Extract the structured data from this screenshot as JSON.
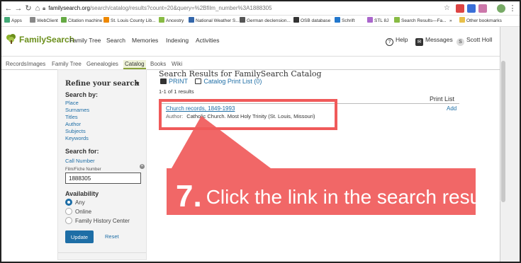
{
  "browser": {
    "url_host": "familysearch.org",
    "url_path": "/search/catalog/results?count=20&query=%2Bfilm_number%3A1888305",
    "bookmarks": [
      "Apps",
      "WebClient",
      "Citation machine",
      "St. Louis County Lib...",
      "Ancestry",
      "National Weather S...",
      "German declension...",
      "OSB database",
      "Schrift",
      "STL 8J",
      "Search Results—Fa...",
      "»",
      "Other bookmarks"
    ]
  },
  "site": {
    "logo": "FamilySearch",
    "nav": [
      "Family Tree",
      "Search",
      "Memories",
      "Indexing",
      "Activities"
    ],
    "help": "Help",
    "messages": "Messages",
    "user_initial": "S",
    "user_name": "Scott Holl",
    "subnav": [
      "Records",
      "Images",
      "Family Tree",
      "Genealogies",
      "Catalog",
      "Books",
      "Wiki"
    ]
  },
  "sidebar": {
    "title": "Refine your search",
    "search_by": "Search by:",
    "search_by_links": [
      "Place",
      "Surnames",
      "Titles",
      "Author",
      "Subjects",
      "Keywords"
    ],
    "search_for": "Search for:",
    "call_number": "Call Number",
    "film_label": "Film/Fiche Number",
    "film_value": "1888305",
    "availability": "Availability",
    "availability_options": [
      "Any",
      "Online",
      "Family History Center"
    ],
    "update": "Update",
    "reset": "Reset"
  },
  "results": {
    "title": "Search Results for FamilySearch Catalog",
    "print": "PRINT",
    "print_list": "Catalog Print List (0)",
    "count": "1-1 of 1 results",
    "print_list_header": "Print List",
    "items": [
      {
        "title": "Church records, 1849-1993",
        "author_label": "Author:",
        "author": "Catholic Church. Most Holy Trinity (St. Louis, Missouri)",
        "add": "Add"
      }
    ]
  },
  "annotation": {
    "step": "7.",
    "text": "Click the link in the search results",
    "color": "#f05a5a"
  }
}
